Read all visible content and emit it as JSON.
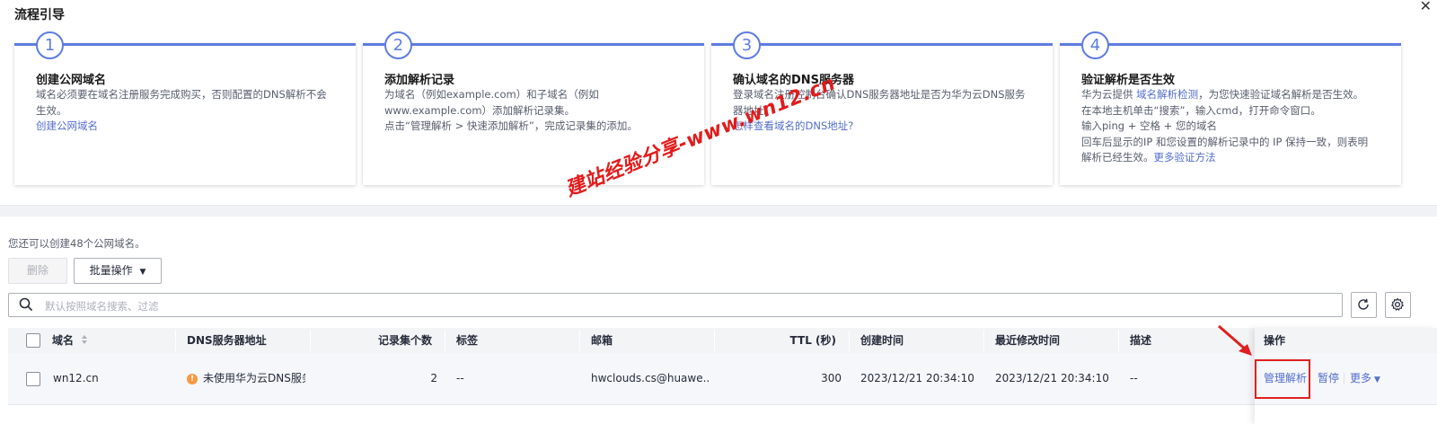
{
  "guide": {
    "title": "流程引导",
    "steps": [
      {
        "number": "1",
        "title": "创建公网域名",
        "lines": [
          "域名必须要在域名注册服务完成购买，否则配置的DNS解析不会",
          "生效。"
        ],
        "link": "创建公网域名"
      },
      {
        "number": "2",
        "title": "添加解析记录",
        "lines": [
          "为域名（例如example.com）和子域名（例如",
          "www.example.com）添加解析记录集。",
          "点击“管理解析 > 快速添加解析”，完成记录集的添加。"
        ]
      },
      {
        "number": "3",
        "title": "确认域名的DNS服务器",
        "lines": [
          "登录域名注册控制台确认DNS服务器地址是否为华为云DNS服务",
          "器地址。"
        ],
        "link": "怎样查看域名的DNS地址?"
      },
      {
        "number": "4",
        "title": "验证解析是否生效",
        "line1_prefix": "华为云提供 ",
        "line1_link": "域名解析检测",
        "line1_suffix": "，为您快速验证域名解析是否生效。",
        "lines": [
          "在本地主机单击“搜索”，输入cmd，打开命令窗口。",
          "输入ping + 空格 + 您的域名",
          "回车后显示的IP 和您设置的解析记录中的 IP 保持一致，则表明"
        ],
        "last_prefix": "解析已经生效。",
        "last_link": "更多验证方法"
      }
    ]
  },
  "watermark": "建站经验分享-www.wn12.cn",
  "toolbar": {
    "quota_text": "您还可以创建48个公网域名。",
    "delete_label": "删除",
    "batch_label": "批量操作"
  },
  "search": {
    "placeholder": "默认按照域名搜索、过滤"
  },
  "table": {
    "headers": {
      "domain": "域名",
      "dns": "DNS服务器地址",
      "records": "记录集个数",
      "tags": "标签",
      "email": "邮箱",
      "ttl": "TTL (秒)",
      "created": "创建时间",
      "modified": "最近修改时间",
      "desc": "描述",
      "ops": "操作"
    },
    "rows": [
      {
        "domain": "wn12.cn",
        "dns": "未使用华为云DNS服务器",
        "records": "2",
        "tags": "--",
        "email": "hwclouds.cs@huawe...",
        "ttl": "300",
        "created": "2023/12/21 20:34:10 ...",
        "modified": "2023/12/21 20:34:10 ...",
        "desc": "--",
        "op_manage": "管理解析",
        "op_pause": "暂停",
        "op_more": "更多"
      }
    ]
  },
  "colors": {
    "accent": "#5e7ce0",
    "link": "#526ecc",
    "warning": "#fa9841",
    "highlight": "#e02020"
  }
}
